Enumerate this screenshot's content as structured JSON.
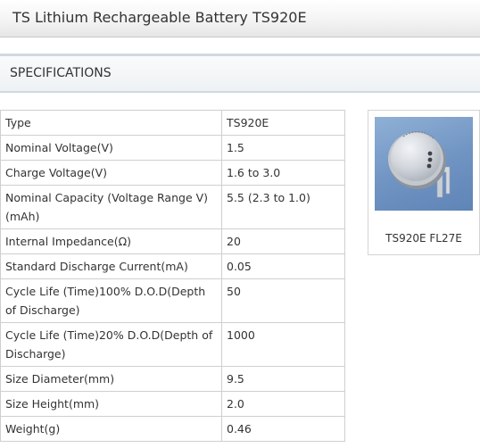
{
  "page": {
    "title": "TS Lithium Rechargeable Battery TS920E",
    "section_heading": "SPECIFICATIONS"
  },
  "specs": [
    {
      "label": "Type",
      "value": "TS920E"
    },
    {
      "label": "Nominal Voltage(V)",
      "value": "1.5"
    },
    {
      "label": "Charge Voltage(V)",
      "value": "1.6 to 3.0"
    },
    {
      "label": "Nominal Capacity (Voltage Range V)(mAh)",
      "value": "5.5 (2.3 to 1.0)"
    },
    {
      "label": "Internal Impedance(Ω)",
      "value": "20"
    },
    {
      "label": "Standard Discharge Current(mA)",
      "value": "0.05"
    },
    {
      "label": "Cycle Life (Time)100% D.O.D(Depth of Discharge)",
      "value": "50"
    },
    {
      "label": "Cycle Life (Time)20% D.O.D(Depth of Discharge)",
      "value": "1000"
    },
    {
      "label": "Size Diameter(mm)",
      "value": "9.5"
    },
    {
      "label": "Size Height(mm)",
      "value": "2.0"
    },
    {
      "label": "Weight(g)",
      "value": "0.46"
    }
  ],
  "product": {
    "caption": "TS920E FL27E",
    "image_icon": "coin-battery-photo",
    "image_background": "#7a9ccb"
  }
}
